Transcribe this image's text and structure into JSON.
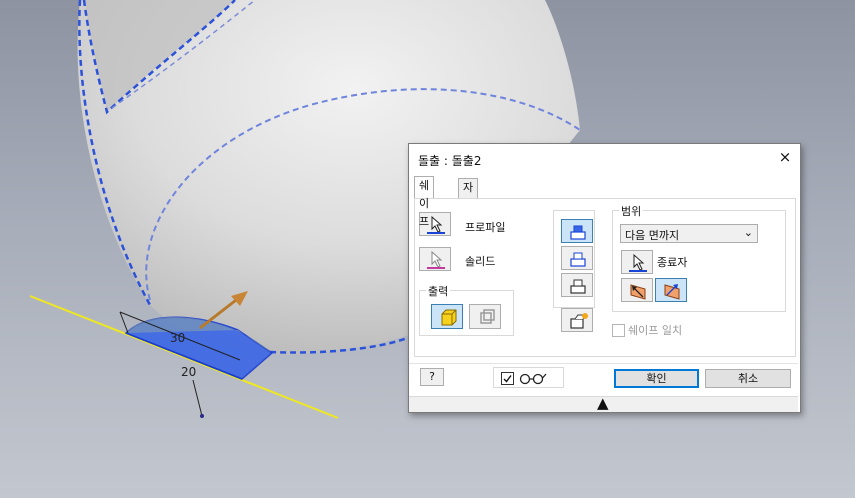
{
  "viewport": {
    "dim_label_30": "30",
    "dim_label_20": "20"
  },
  "dialog": {
    "title": "돌출 : 돌출2",
    "close_glyph": "×",
    "tabs": [
      {
        "label": "쉐이프",
        "active": true
      },
      {
        "label": "자세히",
        "active": false
      }
    ],
    "profile_label": "프로파일",
    "solid_label": "솔리드",
    "output_group_title": "출력",
    "extents_group_title": "범위",
    "extents_select_value": "다음 면까지",
    "terminator_label": "종료자",
    "match_shape_label": "쉐이프 일치",
    "match_shape_checked": false,
    "preview_checked": true,
    "ok_label": "확인",
    "cancel_label": "취소",
    "help_glyph": "?",
    "expander_glyph": "▲",
    "icons": {
      "profile": "select-arrow-icon",
      "solid": "select-arrow-pink-icon",
      "output_solid": "solid-cube-icon",
      "output_surface": "surface-icon",
      "operation_join": "join-icon",
      "operation_cut": "cut-icon",
      "operation_intersect": "intersect-icon",
      "new_solid": "new-solid-icon",
      "direction_1": "direction-flip-icon",
      "direction_2": "direction-default-icon",
      "glasses": "preview-glasses-icon"
    },
    "colors": {
      "accent": "#0078d7",
      "pressed": "#cce4f7",
      "profile_blue": "#1a44d6"
    }
  }
}
